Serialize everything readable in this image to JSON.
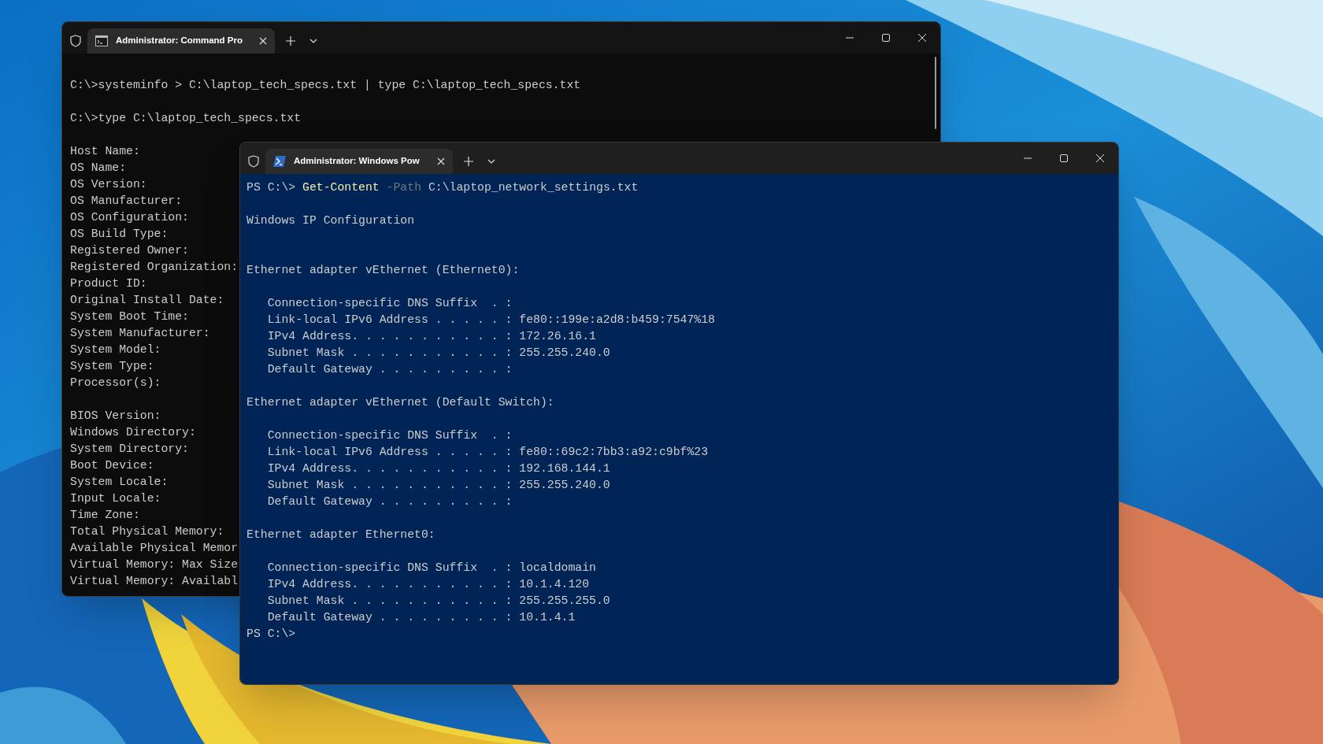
{
  "windows": [
    {
      "kind": "cmd",
      "tab": {
        "title": "Administrator: Command Pro",
        "selected": true
      },
      "lines": [
        {
          "kind": "text",
          "text": "C:\\>systeminfo > C:\\laptop_tech_specs.txt | type C:\\laptop_tech_specs.txt"
        },
        {
          "kind": "blank"
        },
        {
          "kind": "text",
          "text": "C:\\>type C:\\laptop_tech_specs.txt"
        },
        {
          "kind": "blank"
        },
        {
          "kind": "text",
          "text": "Host Name:"
        },
        {
          "kind": "text",
          "text": "OS Name:"
        },
        {
          "kind": "text",
          "text": "OS Version:"
        },
        {
          "kind": "text",
          "text": "OS Manufacturer:"
        },
        {
          "kind": "text",
          "text": "OS Configuration:"
        },
        {
          "kind": "text",
          "text": "OS Build Type:"
        },
        {
          "kind": "text",
          "text": "Registered Owner:"
        },
        {
          "kind": "text",
          "text": "Registered Organization:"
        },
        {
          "kind": "text",
          "text": "Product ID:"
        },
        {
          "kind": "text",
          "text": "Original Install Date:"
        },
        {
          "kind": "text",
          "text": "System Boot Time:"
        },
        {
          "kind": "text",
          "text": "System Manufacturer:"
        },
        {
          "kind": "text",
          "text": "System Model:"
        },
        {
          "kind": "text",
          "text": "System Type:"
        },
        {
          "kind": "text",
          "text": "Processor(s):"
        },
        {
          "kind": "blank"
        },
        {
          "kind": "text",
          "text": "BIOS Version:"
        },
        {
          "kind": "text",
          "text": "Windows Directory:"
        },
        {
          "kind": "text",
          "text": "System Directory:"
        },
        {
          "kind": "text",
          "text": "Boot Device:"
        },
        {
          "kind": "text",
          "text": "System Locale:"
        },
        {
          "kind": "text",
          "text": "Input Locale:"
        },
        {
          "kind": "text",
          "text": "Time Zone:"
        },
        {
          "kind": "text",
          "text": "Total Physical Memory:"
        },
        {
          "kind": "text",
          "text": "Available Physical Memor"
        },
        {
          "kind": "text",
          "text": "Virtual Memory: Max Size"
        },
        {
          "kind": "text",
          "text": "Virtual Memory: Availabl"
        }
      ]
    },
    {
      "kind": "powershell",
      "tab": {
        "title": "Administrator: Windows Pow",
        "selected": true
      },
      "lines": [
        {
          "kind": "command",
          "segments": [
            {
              "kind": "prompt",
              "text": "PS C:\\> "
            },
            {
              "kind": "cmdlet",
              "text": "Get-Content"
            },
            {
              "kind": "parameter",
              "text": " -Path"
            },
            {
              "kind": "argument",
              "text": " C:\\laptop_network_settings.txt"
            }
          ]
        },
        {
          "kind": "blank"
        },
        {
          "kind": "text",
          "text": "Windows IP Configuration"
        },
        {
          "kind": "blank"
        },
        {
          "kind": "blank"
        },
        {
          "kind": "text",
          "text": "Ethernet adapter vEthernet (Ethernet0):"
        },
        {
          "kind": "blank"
        },
        {
          "kind": "text",
          "text": "   Connection-specific DNS Suffix  . :"
        },
        {
          "kind": "text",
          "text": "   Link-local IPv6 Address . . . . . : fe80::199e:a2d8:b459:7547%18"
        },
        {
          "kind": "text",
          "text": "   IPv4 Address. . . . . . . . . . . : 172.26.16.1"
        },
        {
          "kind": "text",
          "text": "   Subnet Mask . . . . . . . . . . . : 255.255.240.0"
        },
        {
          "kind": "text",
          "text": "   Default Gateway . . . . . . . . . :"
        },
        {
          "kind": "blank"
        },
        {
          "kind": "text",
          "text": "Ethernet adapter vEthernet (Default Switch):"
        },
        {
          "kind": "blank"
        },
        {
          "kind": "text",
          "text": "   Connection-specific DNS Suffix  . :"
        },
        {
          "kind": "text",
          "text": "   Link-local IPv6 Address . . . . . : fe80::69c2:7bb3:a92:c9bf%23"
        },
        {
          "kind": "text",
          "text": "   IPv4 Address. . . . . . . . . . . : 192.168.144.1"
        },
        {
          "kind": "text",
          "text": "   Subnet Mask . . . . . . . . . . . : 255.255.240.0"
        },
        {
          "kind": "text",
          "text": "   Default Gateway . . . . . . . . . :"
        },
        {
          "kind": "blank"
        },
        {
          "kind": "text",
          "text": "Ethernet adapter Ethernet0:"
        },
        {
          "kind": "blank"
        },
        {
          "kind": "text",
          "text": "   Connection-specific DNS Suffix  . : localdomain"
        },
        {
          "kind": "text",
          "text": "   IPv4 Address. . . . . . . . . . . : 10.1.4.120"
        },
        {
          "kind": "text",
          "text": "   Subnet Mask . . . . . . . . . . . : 255.255.255.0"
        },
        {
          "kind": "text",
          "text": "   Default Gateway . . . . . . . . . : 10.1.4.1"
        },
        {
          "kind": "text",
          "text": "PS C:\\>"
        }
      ]
    }
  ]
}
